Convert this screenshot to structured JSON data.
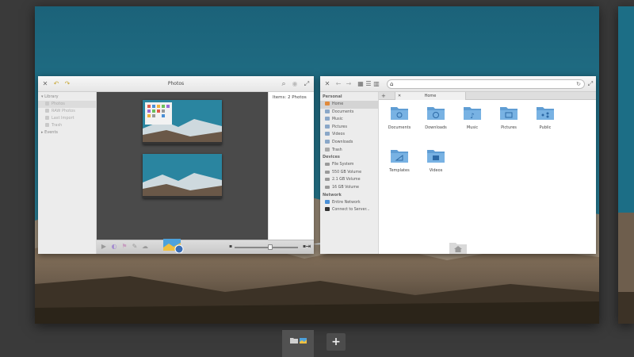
{
  "workspace": {
    "photos_window": {
      "title": "Photos",
      "sidebar": {
        "library_header": "Library",
        "items": [
          "Photos",
          "RAW Photos",
          "Last Import",
          "Trash"
        ],
        "events_header": "Events"
      },
      "items_count": "Items: 2 Photos"
    },
    "files_window": {
      "sidebar": {
        "personal_header": "Personal",
        "personal_items": [
          "Home",
          "Documents",
          "Music",
          "Pictures",
          "Videos",
          "Downloads",
          "Trash"
        ],
        "devices_header": "Devices",
        "device_items": [
          "File System",
          "550 GB Volume",
          "2.1 GB Volume",
          "16 GB Volume"
        ],
        "network_header": "Network",
        "network_items": [
          "Entire Network",
          "Connect to Server..."
        ]
      },
      "tab_label": "Home",
      "folders": [
        "Documents",
        "Downloads",
        "Music",
        "Pictures",
        "Public",
        "Templates",
        "Videos"
      ]
    }
  },
  "dock": {
    "add_label": "+"
  },
  "colors": {
    "background": "#3a3a3a",
    "sky": "#1c6e86",
    "folder_blue": "#5f9dd4"
  }
}
